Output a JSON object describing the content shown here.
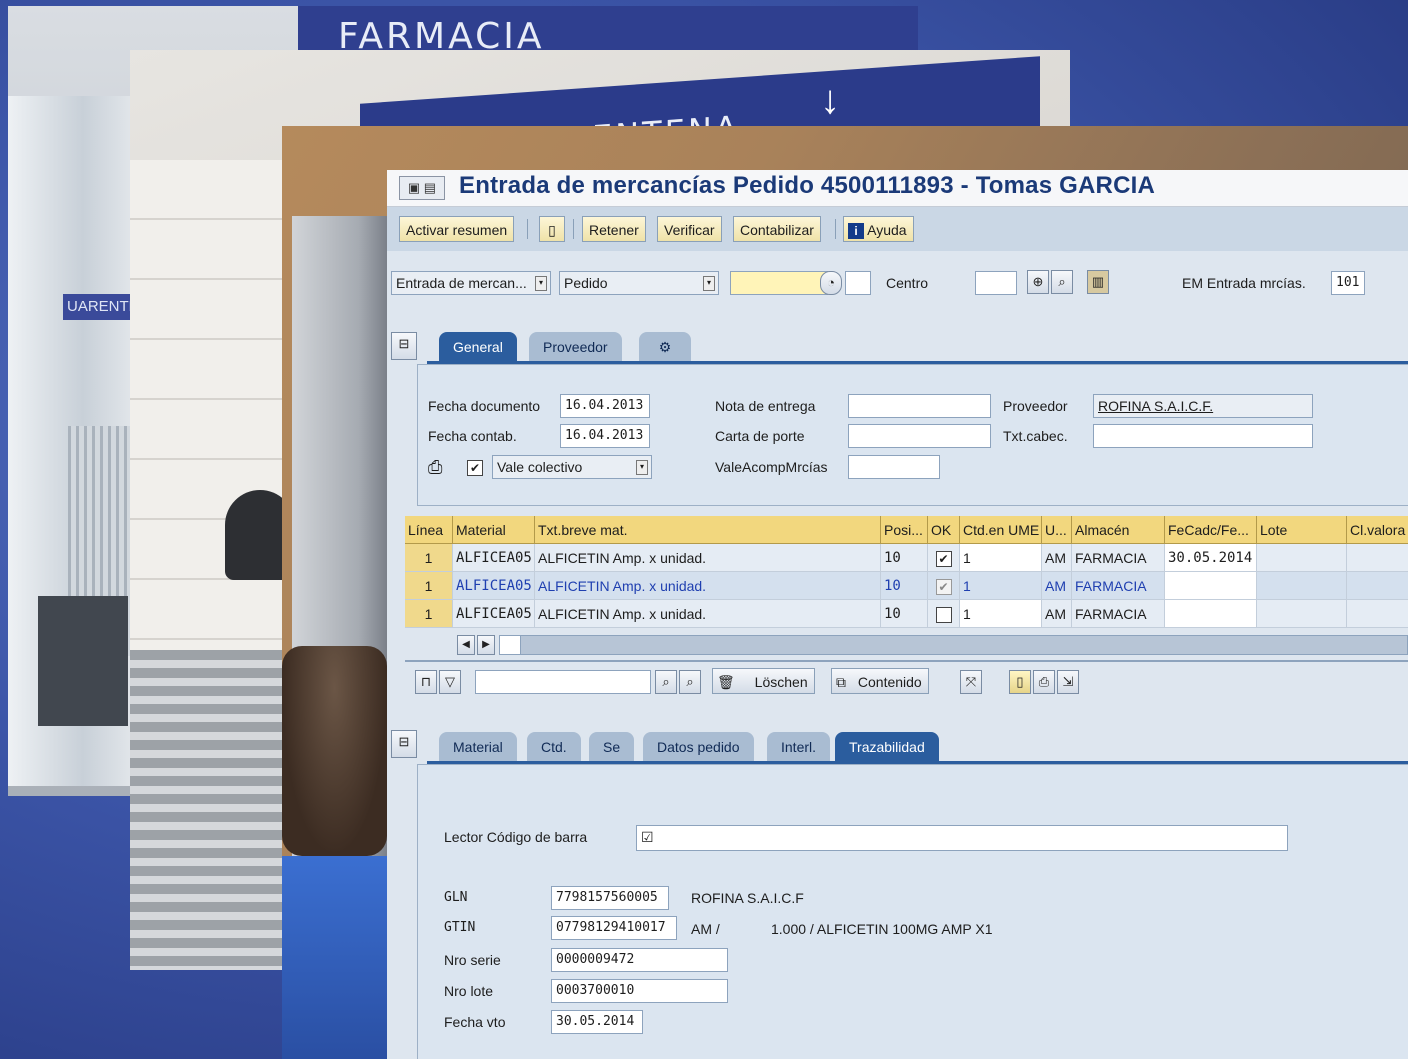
{
  "backdrop": {
    "sign1": "FARMACIA",
    "sign2": "CUARENTENA",
    "sign3": "UARENTE"
  },
  "window": {
    "title": "Entrada de mercancías Pedido 4500111893 - Tomas GARCIA"
  },
  "toolbar": {
    "activar_resumen": "Activar resumen",
    "retener": "Retener",
    "verificar": "Verificar",
    "contabilizar": "Contabilizar",
    "ayuda": "Ayuda"
  },
  "selection": {
    "transaction_select": "Entrada de mercan...",
    "reference_select": "Pedido",
    "order_input": "",
    "centro_label": "Centro",
    "centro_value": "",
    "em_label": "EM Entrada mrcías.",
    "em_value": "101"
  },
  "header_tabs": [
    "General",
    "Proveedor"
  ],
  "general": {
    "fecha_doc_label": "Fecha documento",
    "fecha_doc_value": "16.04.2013",
    "fecha_contab_label": "Fecha contab.",
    "fecha_contab_value": "16.04.2013",
    "vale_select": "Vale colectivo",
    "nota_label": "Nota de entrega",
    "nota_value": "",
    "carta_label": "Carta de porte",
    "carta_value": "",
    "vale_label": "ValeAcompMrcías",
    "vale_value": "",
    "proveedor_label": "Proveedor",
    "proveedor_value": "ROFINA S.A.I.C.F.",
    "txt_label": "Txt.cabec.",
    "txt_value": ""
  },
  "items_table": {
    "columns": [
      "Línea",
      "Material",
      "Txt.breve mat.",
      "Posi...",
      "OK",
      "Ctd.en UME",
      "U...",
      "Almacén",
      "FeCadc/Fe...",
      "Lote",
      "Cl.valora"
    ],
    "rows": [
      {
        "linea": "1",
        "material": "ALFICEA05",
        "texto": "ALFICETIN Amp. x unidad.",
        "pos": "10",
        "ok": "✔",
        "ctd": "1",
        "um": "AM",
        "almacen": "FARMACIA",
        "fecha": "30.05.2014",
        "lote": "",
        "cl": ""
      },
      {
        "linea": "1",
        "material": "ALFICEA05",
        "texto": "ALFICETIN Amp. x unidad.",
        "pos": "10",
        "ok": "✔",
        "ctd": "1",
        "um": "AM",
        "almacen": "FARMACIA",
        "fecha": "",
        "lote": "",
        "cl": ""
      },
      {
        "linea": "1",
        "material": "ALFICEA05",
        "texto": "ALFICETIN Amp. x unidad.",
        "pos": "10",
        "ok": "",
        "ctd": "1",
        "um": "AM",
        "almacen": "FARMACIA",
        "fecha": "",
        "lote": "",
        "cl": ""
      }
    ]
  },
  "item_toolbar": {
    "loschen": "Löschen",
    "contenido": "Contenido"
  },
  "detail_tabs": [
    "Material",
    "Ctd.",
    "Se",
    "Datos pedido",
    "Interl.",
    "Trazabilidad"
  ],
  "trazabilidad": {
    "lector_label": "Lector Código de barra",
    "lector_value": "☑",
    "gln_label": "GLN",
    "gln_value": "7798157560005",
    "gln_desc": "ROFINA S.A.I.C.F",
    "gtin_label": "GTIN",
    "gtin_value": "07798129410017",
    "gtin_unit": "AM /",
    "gtin_desc": "1.000 / ALFICETIN 100MG AMP X1",
    "serie_label": "Nro serie",
    "serie_value": "0000009472",
    "lote_label": "Nro lote",
    "lote_value": "0003700010",
    "vto_label": "Fecha vto",
    "vto_value": "30.05.2014"
  }
}
